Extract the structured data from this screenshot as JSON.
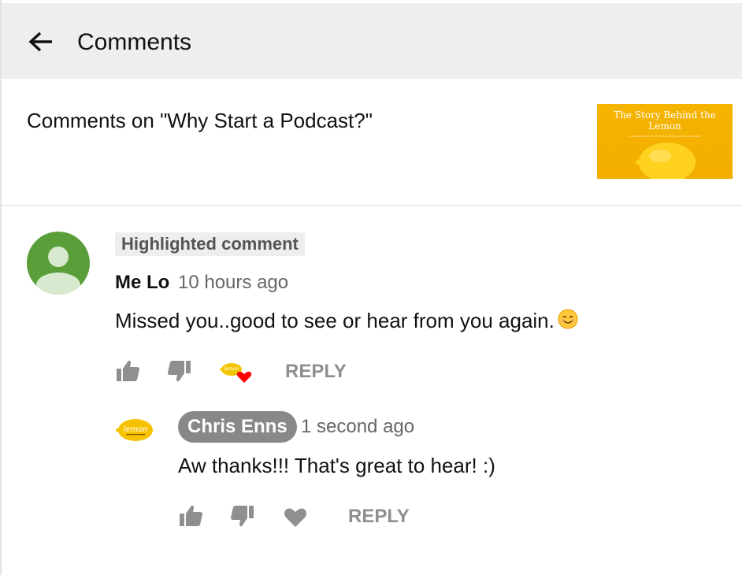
{
  "header": {
    "title": "Comments",
    "back_icon": "arrow-left-icon"
  },
  "video": {
    "comments_on": "Comments on \"Why Start a Podcast?\"",
    "thumbnail": {
      "title": "The Story Behind the Lemon",
      "subtitle": "A podcast about a business that produces podcasts"
    }
  },
  "comment": {
    "badge": "Highlighted comment",
    "author": "Me Lo",
    "time": "10 hours ago",
    "text": "Missed you..good to see or hear from you again.",
    "emoji": "smiling-face-icon",
    "creator_heart_logo": "lemon",
    "actions": {
      "like_icon": "thumbs-up-icon",
      "dislike_icon": "thumbs-down-icon",
      "creator_heart_icon": "creator-heart-icon",
      "reply": "REPLY"
    }
  },
  "reply": {
    "author": "Chris Enns",
    "time": "1 second ago",
    "text": "Aw thanks!!! That's great to hear! :)",
    "avatar_text": "lemon",
    "actions": {
      "like_icon": "thumbs-up-icon",
      "dislike_icon": "thumbs-down-icon",
      "heart_icon": "heart-icon",
      "reply": "REPLY"
    }
  },
  "colors": {
    "header_bg": "#eeeeee",
    "avatar_green": "#5a9e3a",
    "lemon_yellow": "#f5b400",
    "owner_badge": "#888888",
    "heart_red": "#ff0000",
    "action_gray": "#8f8f8f"
  }
}
